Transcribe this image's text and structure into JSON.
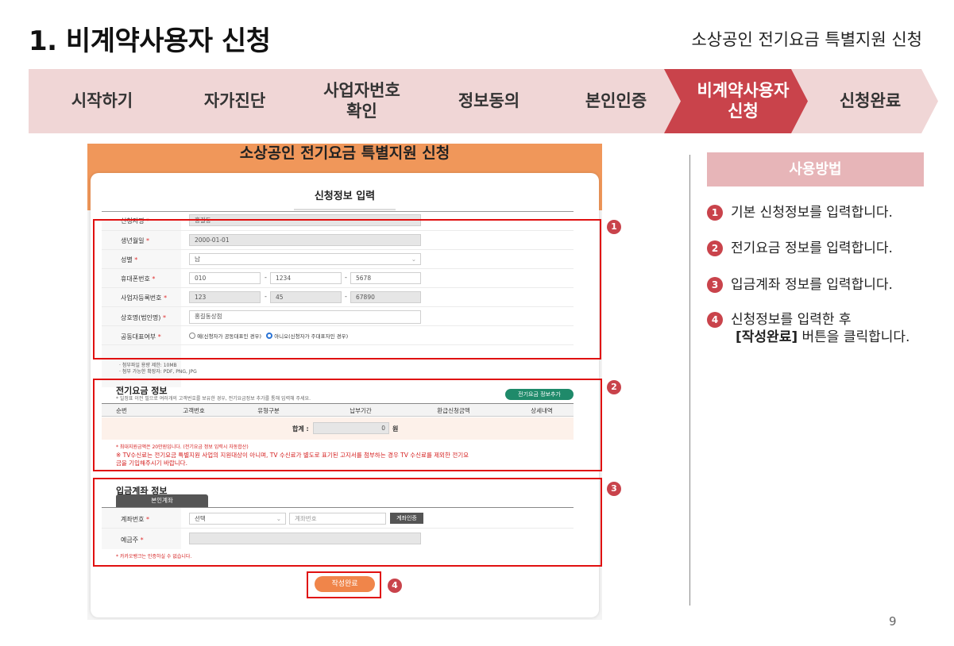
{
  "header": {
    "title": "1. 비계약사용자 신청",
    "subtitle": "소상공인 전기요금 특별지원 신청"
  },
  "steps": [
    {
      "line1": "시작하기",
      "line2": ""
    },
    {
      "line1": "자가진단",
      "line2": ""
    },
    {
      "line1": "사업자번호",
      "line2": "확인"
    },
    {
      "line1": "정보동의",
      "line2": ""
    },
    {
      "line1": "본인인증",
      "line2": ""
    },
    {
      "line1": "비계약사용자",
      "line2": "신청"
    },
    {
      "line1": "신청완료",
      "line2": ""
    }
  ],
  "active_step": 5,
  "mock": {
    "header_title": "소상공인 전기요금 특별지원 신청",
    "card_title": "신청정보 입력",
    "applicant": {
      "name_label": "신청자명",
      "name_value": "홍길동",
      "birth_label": "생년월일",
      "birth_value": "2000-01-01",
      "gender_label": "성별",
      "gender_value": "남",
      "phone_label": "휴대폰번호",
      "phone_1": "010",
      "phone_2": "1234",
      "phone_3": "5678",
      "bizno_label": "사업자등록번호",
      "bizno_1": "123",
      "bizno_2": "45",
      "bizno_3": "67890",
      "corp_label": "상호명(법인명)",
      "corp_value": "홍길동상점",
      "rep_label": "공동대표여부",
      "rep_yes": "예(신청자가 공동대표인 경우)",
      "rep_no": "아니오(신청자가 주대표자인 경우)",
      "required_mark": "*",
      "dash": "-",
      "note_1": "· 첨부파일 용량 제한: 10MB",
      "note_2": "· 첨부 가능한 확장자: PDF, PNG, JPG"
    },
    "electric": {
      "title": "전기요금 정보",
      "desc": "* 일정표 이전 필으로 여러개의 고객번호를 보유한 경우, 전기요금정보 추가를 통해 입력해 주세요.",
      "add_button": "전기요금 정보추가",
      "columns": [
        "순번",
        "고객번호",
        "유형구분",
        "납부기간",
        "환급신청금액",
        "상세내역"
      ],
      "total_label": "합계 :",
      "total_value": "0",
      "total_unit": "원",
      "note_1": "* 최대지원금액은 20만원입니다. (전기요금 정보 입력시 자동합산)",
      "note_2": "※ TV수신료는 전기요금 특별지원 사업의 지원대상이 아니며, TV 수신료가 별도로 표기된 고지서를 첨부하는 경우 TV 수신료를 제외한 전기요",
      "note_3": "금을 기입해주시기 바랍니다."
    },
    "account": {
      "title": "입금계좌 정보",
      "tab": "본인계좌",
      "account_label": "계좌번호",
      "bank_select": "선택",
      "account_placeholder": "계좌번호",
      "verify_button": "계좌인증",
      "holder_label": "예금주",
      "note": "* 카카오뱅크는 인증하실 수 없습니다."
    },
    "submit_button": "작성완료"
  },
  "usage": {
    "title": "사용방법",
    "items": [
      {
        "num": "1",
        "text": "기본 신청정보를 입력합니다."
      },
      {
        "num": "2",
        "text": "전기요금 정보를 입력합니다."
      },
      {
        "num": "3",
        "text": "입금계좌 정보를 입력합니다."
      },
      {
        "num": "4",
        "text": "신청정보를 입력한 후",
        "bold": "[작성완료]",
        "text2": " 버튼을 클릭합니다."
      }
    ]
  },
  "page_number": "9",
  "colors": {
    "accent": "#c9434b",
    "step_inactive": "#f0d6d6",
    "mock_header": "#f0975a",
    "annotation": "#e01010"
  }
}
